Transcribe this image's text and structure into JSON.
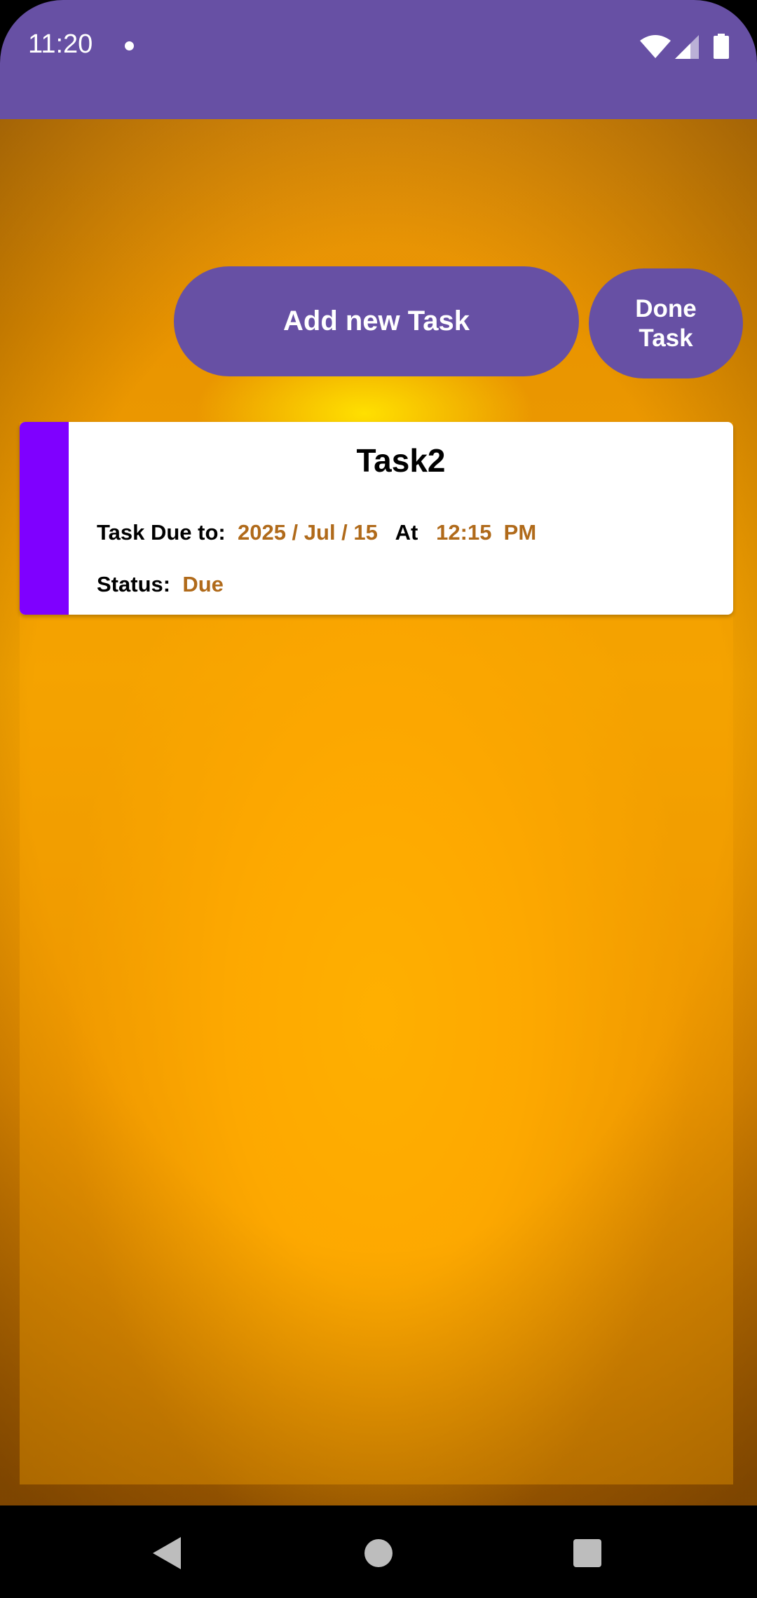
{
  "status_bar": {
    "time": "11:20"
  },
  "toolbar": {
    "add_task_label": "Add new Task",
    "done_task_label": "Done\nTask"
  },
  "task": {
    "title": "Task2",
    "due_label": "Task Due to:",
    "due_date": "2025 / Jul / 15",
    "at_label": "At",
    "due_time": "12:15  PM",
    "status_label": "Status:",
    "status_value": "Due"
  },
  "colors": {
    "app_bar": "#6750A4",
    "accent": "#7F00FF",
    "value_text": "#B06A1A"
  },
  "icons": {
    "status": [
      "wifi-icon",
      "signal-icon",
      "battery-icon"
    ],
    "nav": [
      "back-icon",
      "home-icon",
      "recents-icon"
    ]
  }
}
